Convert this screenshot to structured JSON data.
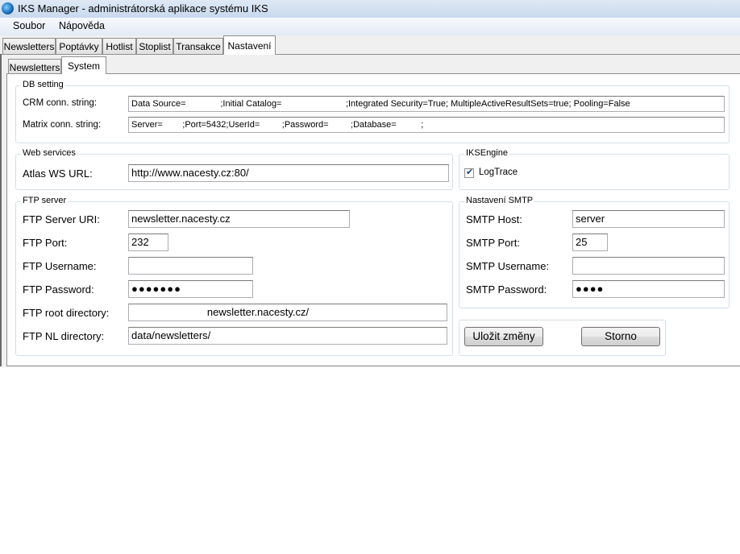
{
  "window": {
    "title": "IKS Manager - administrátorská aplikace systému IKS"
  },
  "menu": {
    "items": [
      "Soubor",
      "Nápověda"
    ]
  },
  "main_tabs": [
    "Newsletters",
    "Poptávky",
    "Hotlist",
    "Stoplist",
    "Transakce",
    "Nastavení"
  ],
  "main_tabs_active": "Nastavení",
  "sub_tabs": [
    "Newsletters",
    "System"
  ],
  "sub_tabs_active": "System",
  "db_setting": {
    "legend": "DB setting",
    "crm_label": "CRM conn. string:",
    "crm_value": "Data Source=              ;Initial Catalog=                          ;Integrated Security=True; MultipleActiveResultSets=true; Pooling=False",
    "matrix_label": "Matrix conn. string:",
    "matrix_value": "Server=        ;Port=5432;UserId=         ;Password=         ;Database=          ;"
  },
  "web_services": {
    "legend": "Web services",
    "atlas_label": "Atlas WS URL:",
    "atlas_value": "http://www.nacesty.cz:80/"
  },
  "iks_engine": {
    "legend": "IKSEngine",
    "logtrace_label": "LogTrace",
    "logtrace_checked": true
  },
  "ftp": {
    "legend": "FTP server",
    "server_label": "FTP Server URI:",
    "server_value": "newsletter.nacesty.cz",
    "port_label": "FTP Port:",
    "port_value": "232",
    "username_label": "FTP Username:",
    "username_value": "",
    "password_label": "FTP Password:",
    "password_value": "●●●●●●●",
    "root_label": "FTP root directory:",
    "root_value": "                          newsletter.nacesty.cz/",
    "nl_label": "FTP NL directory:",
    "nl_value": "data/newsletters/"
  },
  "smtp": {
    "legend": "Nastavení SMTP",
    "host_label": "SMTP Host:",
    "host_value": "server",
    "port_label": "SMTP Port:",
    "port_value": "25",
    "username_label": "SMTP Username:",
    "username_value": "",
    "password_label": "SMTP Password:",
    "password_value": "●●●●"
  },
  "actions": {
    "save_label": "Uložit změny",
    "cancel_label": "Storno"
  }
}
